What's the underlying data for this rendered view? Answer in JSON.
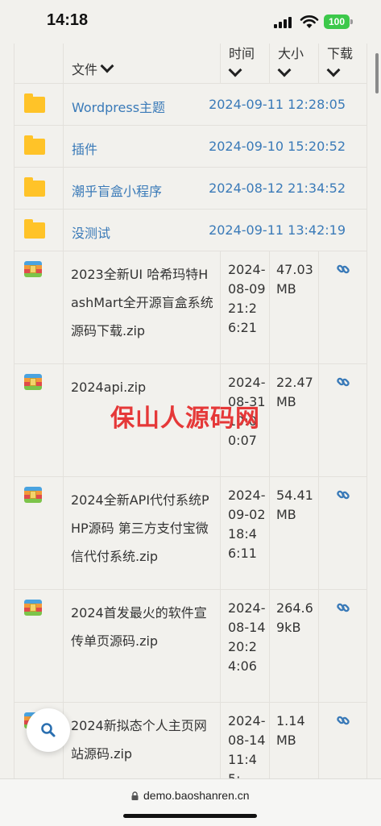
{
  "status_bar": {
    "time": "14:18",
    "battery": "100"
  },
  "table": {
    "headers": {
      "name": "文件",
      "time": "时间",
      "size": "大小",
      "download": "下载"
    },
    "folders": [
      {
        "name": "Wordpress主题",
        "time": "2024-09-11 12:28:05"
      },
      {
        "name": "插件",
        "time": "2024-09-10 15:20:52"
      },
      {
        "name": "潮乎盲盒小程序",
        "time": "2024-08-12 21:34:52"
      },
      {
        "name": "没测试",
        "time": "2024-09-11 13:42:19"
      }
    ],
    "files": [
      {
        "name": "2023全新UI 哈希玛特HashMart全开源盲盒系统源码下载.zip",
        "time": "2024-08-09 21:26:21",
        "size": "47.03MB"
      },
      {
        "name": "2024api.zip",
        "time": "2024-08-31 10:00:07",
        "size": "22.47MB"
      },
      {
        "name": "2024全新API代付系统PHP源码 第三方支付宝微信代付系统.zip",
        "time": "2024-09-02 18:46:11",
        "size": "54.41MB"
      },
      {
        "name": "2024首发最火的软件宣传单页源码.zip",
        "time": "2024-08-14 20:24:06",
        "size": "264.69kB"
      },
      {
        "name": "2024新拟态个人主页网站源码.zip",
        "time": "2024-08-14 11:45:",
        "size": "1.14MB"
      }
    ]
  },
  "watermark": "保山人源码网",
  "url_bar": {
    "url": "demo.baoshanren.cn"
  },
  "colors": {
    "link": "#3a7ab8",
    "watermark": "#e53838",
    "folder": "#ffc328",
    "battery": "#3cc84a"
  }
}
